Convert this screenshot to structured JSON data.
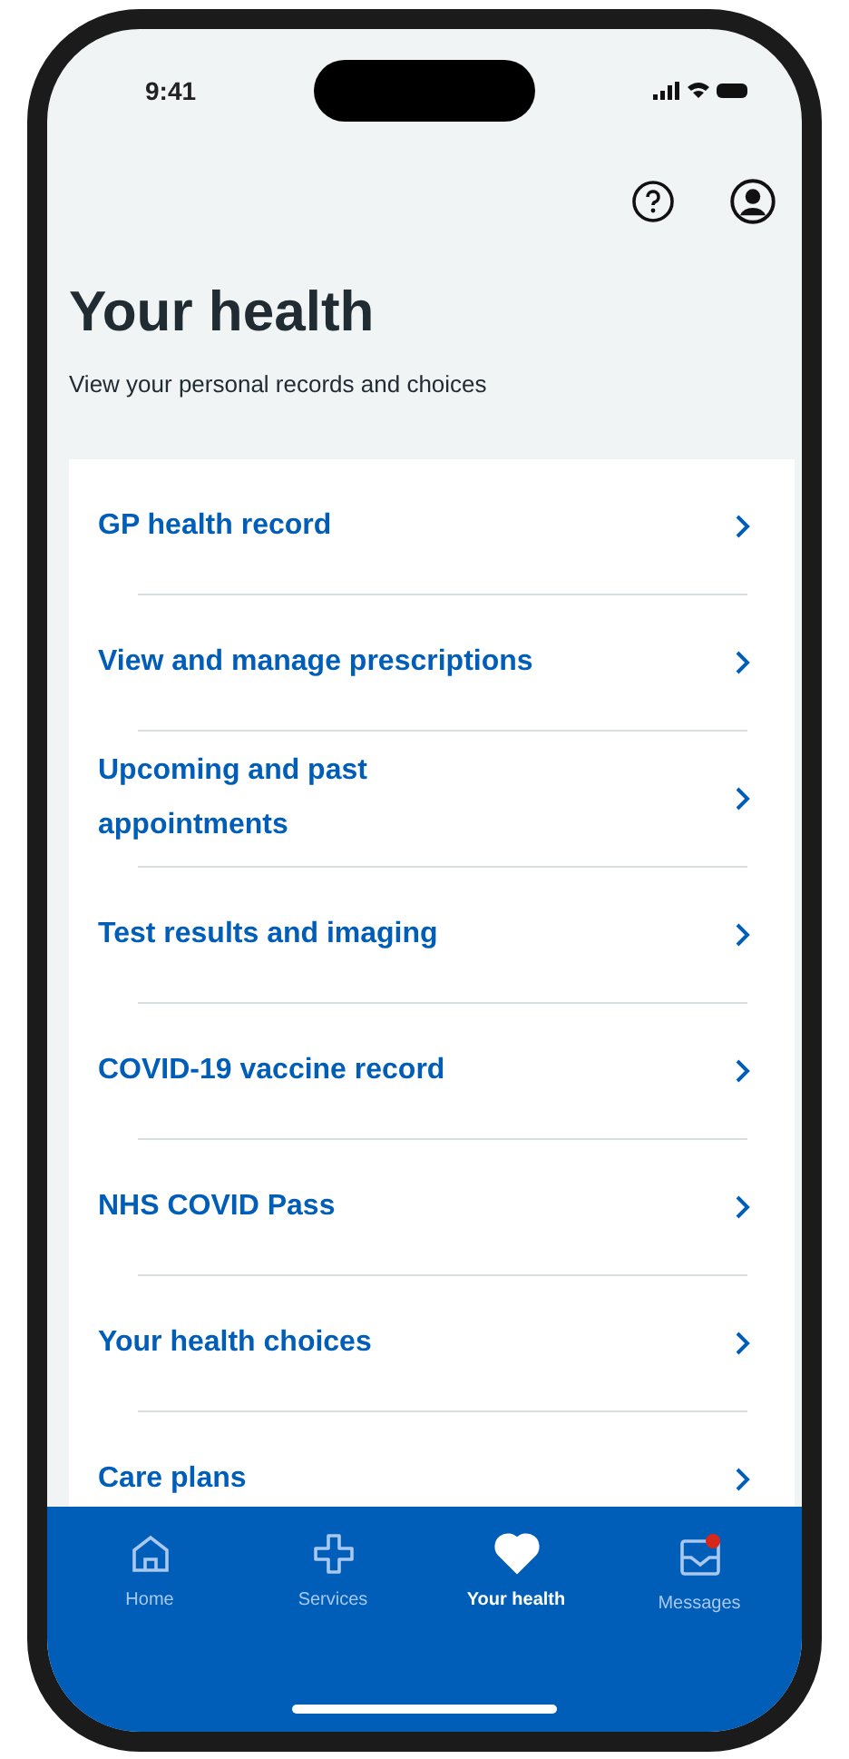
{
  "status_bar": {
    "time": "9:41"
  },
  "title": "Your health",
  "subtitle": "View your personal records and choices",
  "links": [
    {
      "label": "GP health record"
    },
    {
      "label": "View and manage prescriptions"
    },
    {
      "label": "Upcoming and past appointments"
    },
    {
      "label": "Test results and imaging"
    },
    {
      "label": "COVID-19 vaccine record"
    },
    {
      "label": "NHS COVID Pass"
    },
    {
      "label": "Your health choices"
    },
    {
      "label": "Care plans"
    }
  ],
  "nav": [
    {
      "kind": "home",
      "label": "Home",
      "selected": false
    },
    {
      "kind": "services",
      "label": "Services",
      "selected": false
    },
    {
      "kind": "health",
      "label": "Your health",
      "selected": true
    },
    {
      "kind": "messages",
      "label": "Messages",
      "selected": false,
      "badge": true
    }
  ]
}
